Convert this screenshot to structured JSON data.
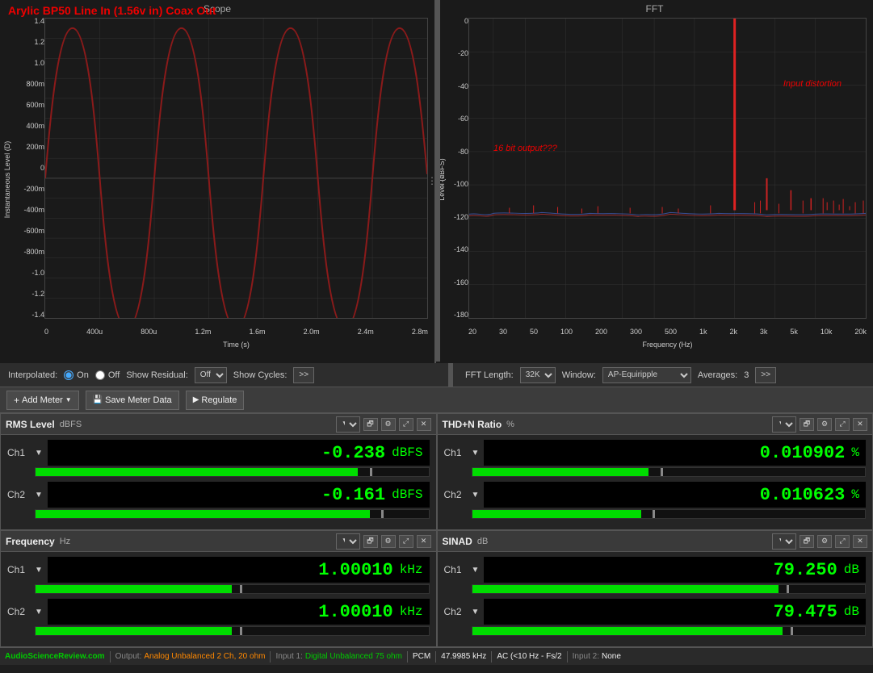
{
  "scope": {
    "title": "Scope",
    "chart_title": "Arylic BP50 Line In (1.56v in) Coax Out",
    "y_labels": [
      "1.4",
      "1.2",
      "1.0",
      "800m",
      "600m",
      "400m",
      "200m",
      "0",
      "-200m",
      "-400m",
      "-600m",
      "-800m",
      "-1.0",
      "-1.2",
      "-1.4"
    ],
    "x_labels": [
      "0",
      "400u",
      "800u",
      "1.2m",
      "1.6m",
      "2.0m",
      "2.4m",
      "2.8m"
    ],
    "x_axis_label": "Time (s)",
    "y_axis_label": "Instantaneous Level (D)"
  },
  "fft": {
    "title": "FFT",
    "annotation1": "16 bit output???",
    "annotation2": "Input distortion",
    "y_labels": [
      "0",
      "-20",
      "-40",
      "-60",
      "-80",
      "-100",
      "-120",
      "-140",
      "-160",
      "-180"
    ],
    "x_labels": [
      "20",
      "30",
      "50",
      "100",
      "200",
      "300",
      "500",
      "1k",
      "2k",
      "3k",
      "5k",
      "10k",
      "20k"
    ],
    "x_axis_label": "Frequency (Hz)",
    "y_axis_label": "Level (dBFS)"
  },
  "controls": {
    "interpolated_label": "Interpolated:",
    "on_label": "On",
    "off_label": "Off",
    "show_residual_label": "Show Residual:",
    "show_residual_value": "Off",
    "show_cycles_label": "Show Cycles:",
    "show_cycles_btn": ">>",
    "fft_length_label": "FFT Length:",
    "fft_length_value": "32K",
    "window_label": "Window:",
    "window_value": "AP-Equiripple",
    "averages_label": "Averages:",
    "averages_value": "3",
    "averages_btn": ">>"
  },
  "toolbar": {
    "add_meter_label": "Add Meter",
    "save_meter_label": "Save Meter Data",
    "regulate_label": "Regulate"
  },
  "meters": {
    "rms": {
      "title": "RMS Level",
      "unit": "dBFS",
      "ch1_value": "-0.238",
      "ch1_unit": "dBFS",
      "ch1_bar_pct": 82,
      "ch1_marker_pct": 85,
      "ch2_value": "-0.161",
      "ch2_unit": "dBFS",
      "ch2_bar_pct": 85,
      "ch2_marker_pct": 88
    },
    "thdn": {
      "title": "THD+N Ratio",
      "unit": "%",
      "ch1_value": "0.010902",
      "ch1_unit": "%",
      "ch1_bar_pct": 45,
      "ch1_marker_pct": 48,
      "ch2_value": "0.010623",
      "ch2_unit": "%",
      "ch2_bar_pct": 43,
      "ch2_marker_pct": 46
    },
    "freq": {
      "title": "Frequency",
      "unit": "Hz",
      "ch1_value": "1.00010",
      "ch1_unit": "kHz",
      "ch1_bar_pct": 50,
      "ch1_marker_pct": 52,
      "ch2_value": "1.00010",
      "ch2_unit": "kHz",
      "ch2_bar_pct": 50,
      "ch2_marker_pct": 52
    },
    "sinad": {
      "title": "SINAD",
      "unit": "dB",
      "ch1_value": "79.250",
      "ch1_unit": "dB",
      "ch1_bar_pct": 78,
      "ch1_marker_pct": 80,
      "ch2_value": "79.475",
      "ch2_unit": "dB",
      "ch2_bar_pct": 79,
      "ch2_marker_pct": 81
    }
  },
  "status_bar": {
    "website": "AudioScienceReview.com",
    "output_key": "Output:",
    "output_val": "Analog Unbalanced 2 Ch, 20 ohm",
    "input1_key": "Input 1:",
    "input1_val": "Digital Unbalanced 75 ohm",
    "pcm_key": "PCM",
    "sample_rate_key": "47.9985 kHz",
    "ac_key": "AC (<10 Hz - Fs/2",
    "input2_key": "Input 2:",
    "input2_val": "None"
  },
  "colors": {
    "green": "#00ff00",
    "red": "#cc0000",
    "dark_red": "#8b0000",
    "bg_dark": "#1a1a1a",
    "bg_panel": "#252525",
    "bg_header": "#3a3a3a",
    "grid": "#333",
    "axis": "#444",
    "scope_wave": "#8b1a1a",
    "fft_wave_red": "#cc2222",
    "fft_wave_blue": "#4466cc"
  }
}
